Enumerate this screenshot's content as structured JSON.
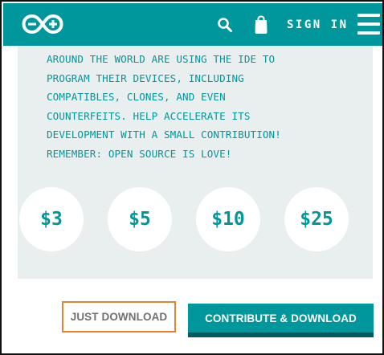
{
  "header": {
    "logo_icon": "arduino-infinity-logo-icon",
    "search_icon": "search-icon",
    "bag_icon": "shopping-bag-icon",
    "signin_label": "SIGN IN",
    "menu_icon": "hamburger-menu-icon",
    "background_color": "#00979c"
  },
  "panel": {
    "message_lines": [
      "AROUND THE WORLD ARE USING THE IDE TO",
      "PROGRAM THEIR DEVICES, INCLUDING",
      "COMPATIBLES, CLONES, AND EVEN",
      "COUNTERFEITS. HELP ACCELERATE ITS",
      "DEVELOPMENT WITH A SMALL CONTRIBUTION!",
      "REMEMBER: OPEN SOURCE IS LOVE!"
    ],
    "amounts": [
      "$3",
      "$5",
      "$10",
      "$25"
    ],
    "background_color": "#e8efee",
    "text_color": "#00979c"
  },
  "actions": {
    "just_download_label": "JUST DOWNLOAD",
    "contribute_download_label": "CONTRIBUTE & DOWNLOAD",
    "highlight_color": "#e9822f"
  }
}
